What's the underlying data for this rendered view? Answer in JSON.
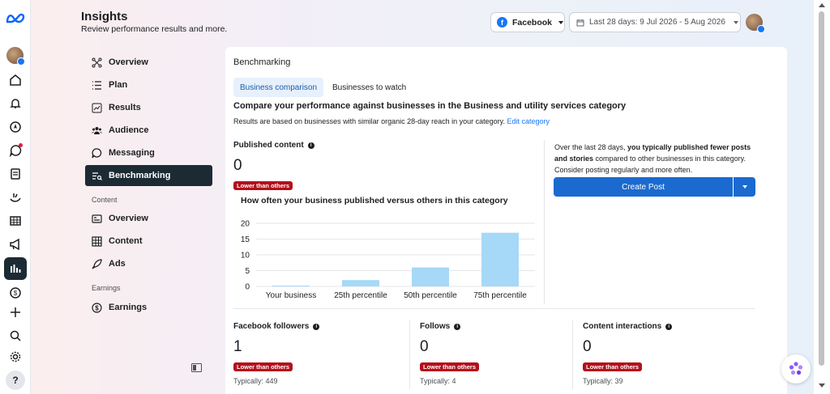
{
  "header": {
    "title": "Insights",
    "subtitle": "Review performance results and more.",
    "platform": "Facebook",
    "date_range": "Last 28 days: 9 Jul 2026 - 5 Aug 2026"
  },
  "rail": {
    "icons": [
      "meta-logo",
      "profile-avatar",
      "home-icon",
      "bell-icon",
      "compass-icon",
      "chat-icon",
      "pages-icon",
      "activity-icon",
      "table-icon",
      "megaphone-icon",
      "insights-icon",
      "dollar-icon",
      "plus-icon",
      "search-icon",
      "settings-icon"
    ],
    "help_label": "?"
  },
  "nav": {
    "items": [
      {
        "label": "Overview",
        "icon": "network-icon"
      },
      {
        "label": "Plan",
        "icon": "list-icon"
      },
      {
        "label": "Results",
        "icon": "chart-line-icon"
      },
      {
        "label": "Audience",
        "icon": "people-icon"
      },
      {
        "label": "Messaging",
        "icon": "chat-bubble-icon"
      },
      {
        "label": "Benchmarking",
        "icon": "benchmark-icon",
        "active": true
      }
    ],
    "content_section": "Content",
    "content_items": [
      {
        "label": "Overview",
        "icon": "content-overview-icon"
      },
      {
        "label": "Content",
        "icon": "grid-icon"
      },
      {
        "label": "Ads",
        "icon": "rocket-icon"
      }
    ],
    "earnings_section": "Earnings",
    "earnings_items": [
      {
        "label": "Earnings",
        "icon": "dollar-circle-icon"
      }
    ]
  },
  "card": {
    "title": "Benchmarking",
    "tabs": [
      "Business comparison",
      "Businesses to watch"
    ],
    "heading": "Compare your performance against businesses in the Business and utility services category",
    "description": "Results are based on businesses with similar organic 28-day reach in your category.",
    "edit_link": "Edit category",
    "published": {
      "label": "Published content",
      "value": "0",
      "badge": "Lower than others"
    },
    "chart_title": "How often your business published versus others in this category",
    "right_text_pre": "Over the last 28 days, ",
    "right_text_bold": "you typically published fewer posts and stories",
    "right_text_post": " compared to other businesses in this category. Consider posting regularly and more often.",
    "create_post": "Create Post",
    "metrics": [
      {
        "label": "Facebook followers",
        "value": "1",
        "badge": "Lower than others",
        "typical": "Typically: 449"
      },
      {
        "label": "Follows",
        "value": "0",
        "badge": "Lower than others",
        "typical": "Typically: 4"
      },
      {
        "label": "Content interactions",
        "value": "0",
        "badge": "Lower than others",
        "typical": "Typically: 39"
      }
    ]
  },
  "colors": {
    "accent": "#1b6ad0",
    "badge": "#b3101c",
    "bar": "#a6d8f7",
    "nav_active": "#1c2b33"
  },
  "chart_data": {
    "type": "bar",
    "categories": [
      "Your business",
      "25th percentile",
      "50th percentile",
      "75th percentile"
    ],
    "values": [
      0,
      2,
      6,
      17
    ],
    "ylim": [
      0,
      20
    ],
    "yticks": [
      "0",
      "5",
      "10",
      "15",
      "20"
    ],
    "grid": true
  }
}
